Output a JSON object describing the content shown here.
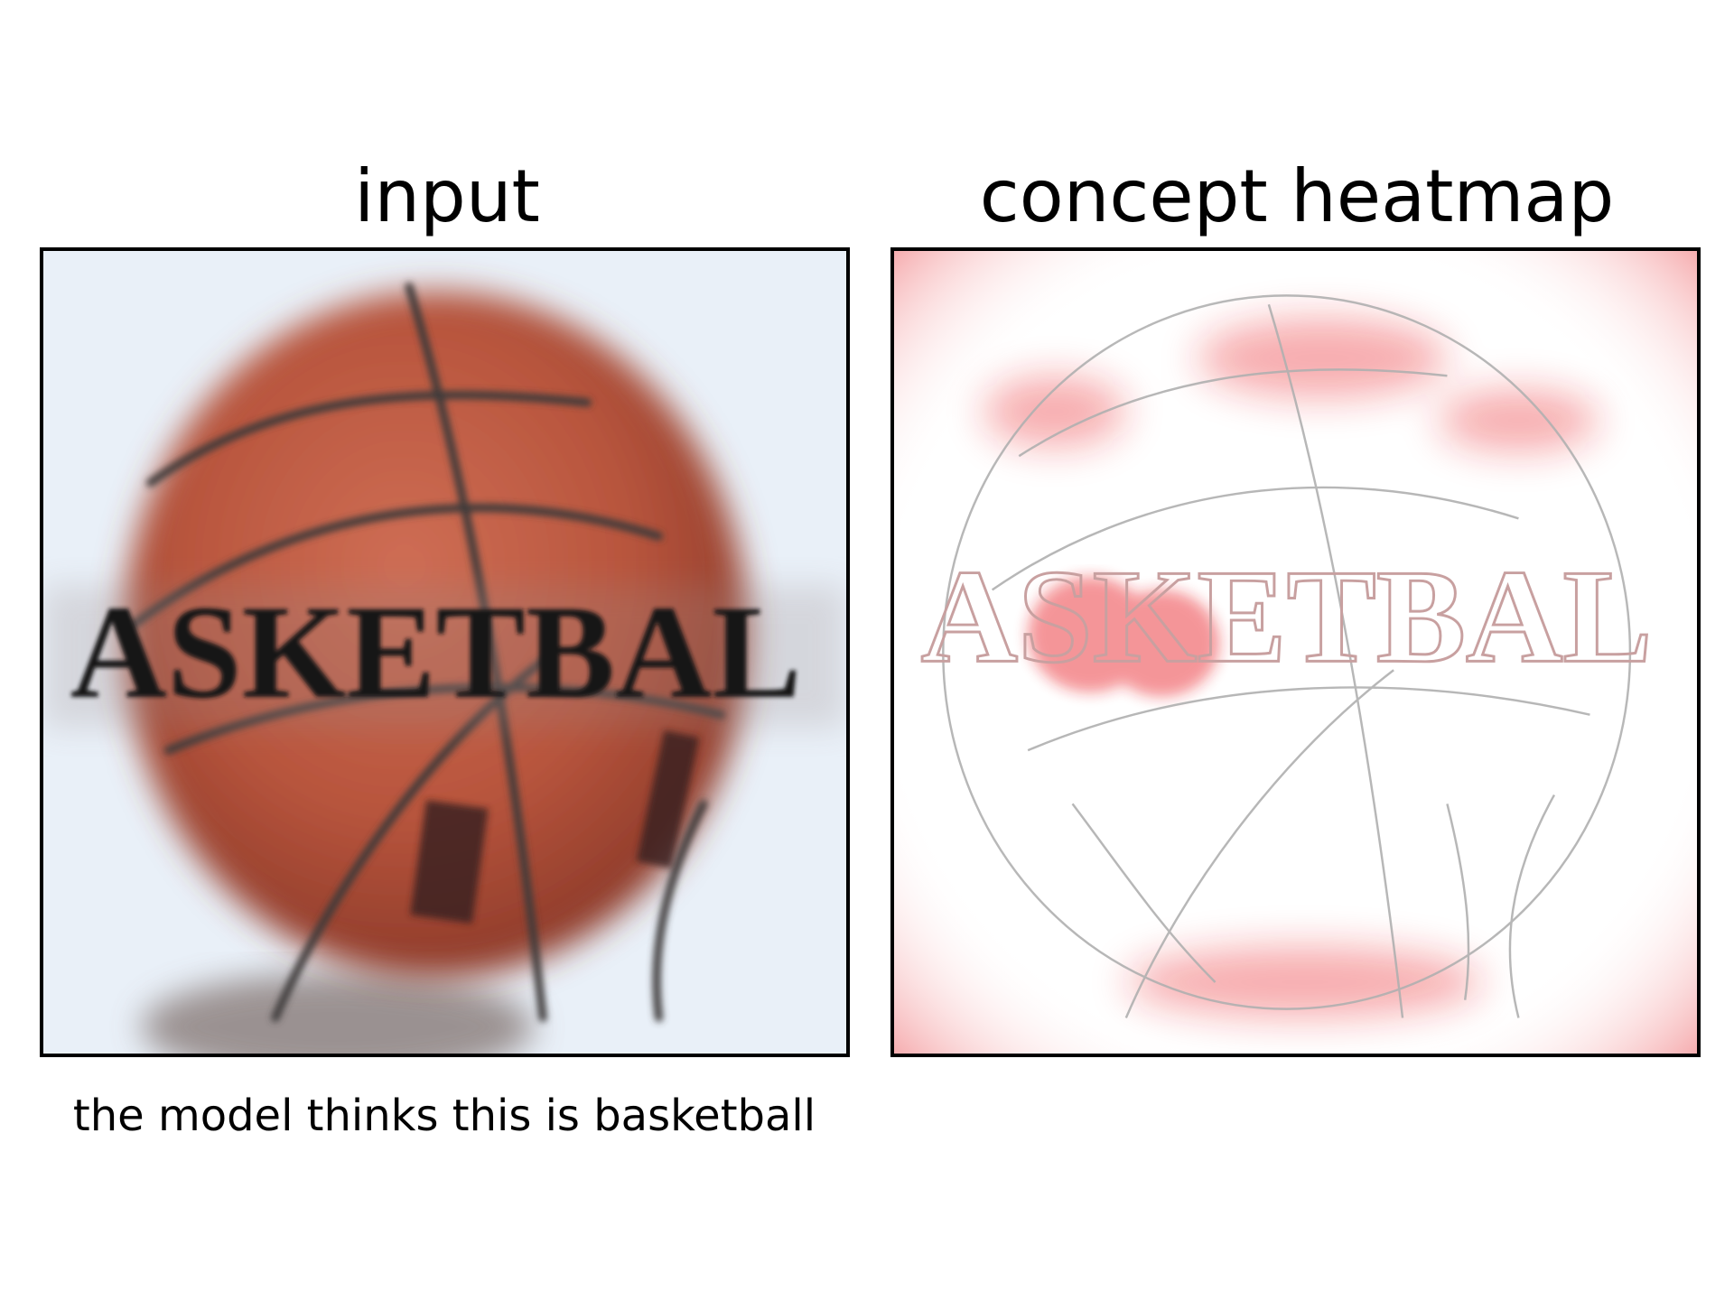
{
  "panels": {
    "input": {
      "title": "input",
      "image_text": "ASKETBAL"
    },
    "heatmap": {
      "title": "concept heatmap",
      "image_text": "ASKETBAL"
    }
  },
  "caption": "the model thinks this is basketball",
  "colors": {
    "background": "#ffffff",
    "ball": "#b8553d",
    "seam": "#3c3a3a",
    "backdrop": "#e9f0f8",
    "heat": "#e8141e",
    "edge": "#b0b0b0"
  }
}
